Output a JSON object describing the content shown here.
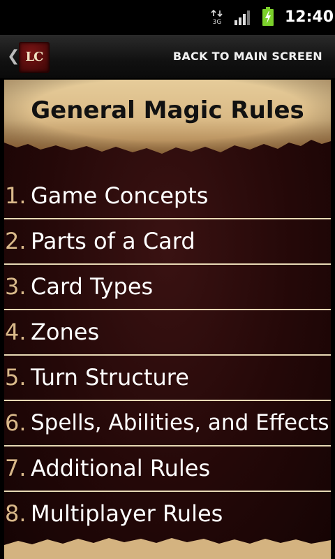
{
  "status_bar": {
    "network": "3G",
    "time": "12:40"
  },
  "header": {
    "logo_text": "LC",
    "back_label": "BACK TO MAIN SCREEN"
  },
  "page": {
    "title": "General Magic Rules"
  },
  "rules": [
    {
      "num": "1.",
      "label": "Game Concepts"
    },
    {
      "num": "2.",
      "label": "Parts of a Card"
    },
    {
      "num": "3.",
      "label": "Card Types"
    },
    {
      "num": "4.",
      "label": "Zones"
    },
    {
      "num": "5.",
      "label": "Turn Structure"
    },
    {
      "num": "6.",
      "label": "Spells, Abilities, and Effects"
    },
    {
      "num": "7.",
      "label": "Additional Rules"
    },
    {
      "num": "8.",
      "label": "Multiplayer Rules"
    }
  ],
  "colors": {
    "background": "#240808",
    "parchment": "#d9bf8f",
    "number": "#d9b98a",
    "divider": "#e8d9b5",
    "battery": "#7bd12b"
  },
  "icons": {
    "network": "data-transfer-icon",
    "signal": "signal-strength-icon",
    "battery": "battery-charging-icon",
    "back": "chevron-left-icon",
    "logo": "app-logo"
  }
}
